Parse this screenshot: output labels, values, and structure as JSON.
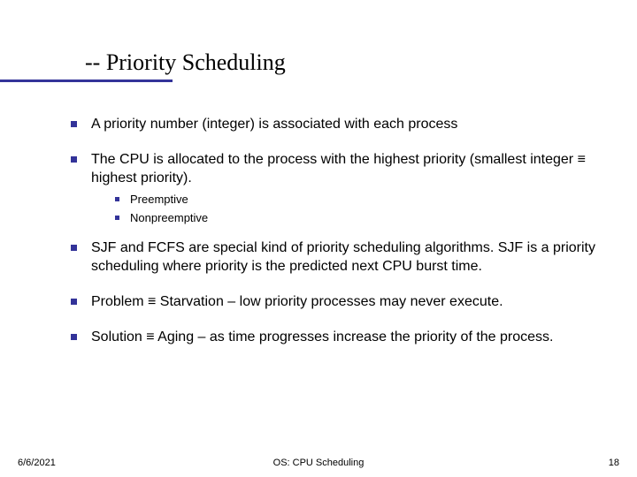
{
  "title": "-- Priority Scheduling",
  "bullets": {
    "b1": "A priority number (integer) is associated with each process",
    "b2": "The CPU is allocated to the process with the highest priority (smallest integer ≡ highest priority).",
    "b2_sub1": "Preemptive",
    "b2_sub2": "Nonpreemptive",
    "b3": "SJF and FCFS are special kind of priority scheduling algorithms. SJF is a priority scheduling where priority is the predicted next CPU burst time.",
    "b4": "Problem ≡ Starvation – low priority processes may never execute.",
    "b5": "Solution ≡ Aging – as time progresses increase the priority of the process."
  },
  "footer": {
    "date": "6/6/2021",
    "center": "OS: CPU Scheduling",
    "page": "18"
  }
}
